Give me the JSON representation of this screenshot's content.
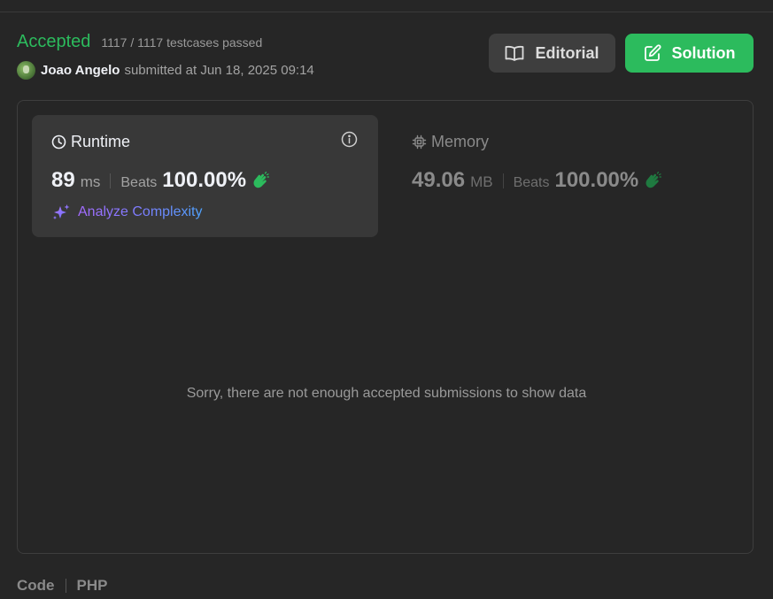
{
  "submission": {
    "status": "Accepted",
    "testcases": "1117 / 1117 testcases passed",
    "username": "Joao Angelo",
    "submitted_text": "submitted at Jun 18, 2025 09:14"
  },
  "actions": {
    "editorial_label": "Editorial",
    "solution_label": "Solution"
  },
  "runtime": {
    "title": "Runtime",
    "value": "89",
    "unit": "ms",
    "beats_label": "Beats",
    "beats_value": "100.00%",
    "analyze_label": "Analyze Complexity"
  },
  "memory": {
    "title": "Memory",
    "value": "49.06",
    "unit": "MB",
    "beats_label": "Beats",
    "beats_value": "100.00%"
  },
  "distribution": {
    "empty_message": "Sorry, there are not enough accepted submissions to show data"
  },
  "code": {
    "label": "Code",
    "language": "PHP"
  },
  "colors": {
    "accepted_green": "#2cbb5d",
    "background": "#262626",
    "card": "#383838"
  },
  "icons": [
    "book-icon",
    "edit-icon",
    "clock-icon",
    "info-icon",
    "clap-icon",
    "sparkle-icon",
    "chip-icon",
    "avatar"
  ]
}
